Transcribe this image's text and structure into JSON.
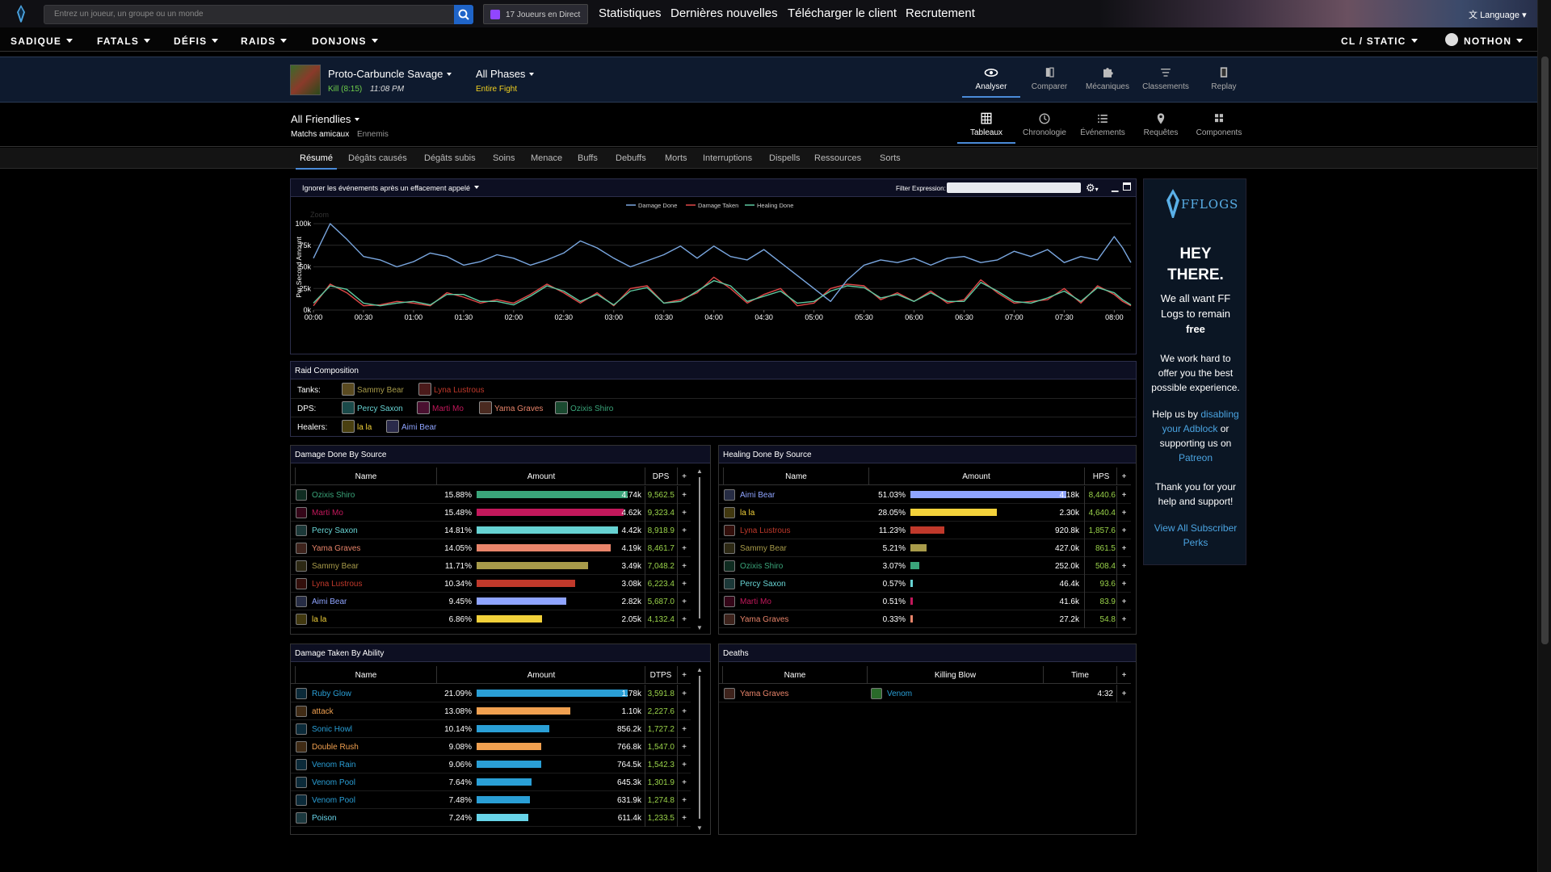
{
  "topbar": {
    "search_placeholder": "Entrez un joueur, un groupe ou un monde",
    "live_label": "17 Joueurs en Direct",
    "nav": [
      "Statistiques",
      "Dernières nouvelles",
      "Télécharger le client",
      "Recrutement"
    ],
    "language": "Language"
  },
  "menubar": {
    "left": [
      "SADIQUE",
      "FATALS",
      "DÉFIS",
      "RAIDS",
      "DONJONS"
    ],
    "static": "CL / STATIC",
    "user": "NOTHON"
  },
  "report": {
    "boss": "Proto-Carbuncle Savage",
    "kill": "Kill (8:15)",
    "time": "11:08 PM",
    "phases": "All Phases",
    "phase_sub": "Entire Fight",
    "view_tabs": [
      "Analyser",
      "Comparer",
      "Mécaniques",
      "Classements",
      "Replay"
    ],
    "view_icons": [
      "eye-icon",
      "compare-icon",
      "puzzle-icon",
      "rankings-icon",
      "replay-icon"
    ]
  },
  "filter": {
    "friendlies": "All Friendlies",
    "matches": "Matchs amicaux",
    "enemies": "Ennemis",
    "mode_tabs": [
      "Tableaux",
      "Chronologie",
      "Événements",
      "Requêtes",
      "Components"
    ],
    "mode_icons": [
      "table-icon",
      "clock-icon",
      "list-icon",
      "pin-icon",
      "grid-icon"
    ]
  },
  "subtabs": [
    "Résumé",
    "Dégâts causés",
    "Dégâts subis",
    "Soins",
    "Menace",
    "Buffs",
    "Debuffs",
    "Morts",
    "Interruptions",
    "Dispells",
    "Ressources",
    "Sorts"
  ],
  "chart_panel": {
    "ignore_label": "Ignorer les événements après un effacement appelé",
    "filter_label": "Filter Expression:",
    "zoom_label": "Zoom"
  },
  "chart_data": {
    "type": "line",
    "ylabel": "Per Second Amount",
    "yticks": [
      "0k",
      "25k",
      "50k",
      "75k",
      "100k"
    ],
    "xticks": [
      "00:00",
      "00:30",
      "01:00",
      "01:30",
      "02:00",
      "02:30",
      "03:00",
      "03:30",
      "04:00",
      "04:30",
      "05:00",
      "05:30",
      "06:00",
      "06:30",
      "07:00",
      "07:30",
      "08:00"
    ],
    "ylim": [
      0,
      100
    ],
    "xlim": [
      0,
      490
    ],
    "series": [
      {
        "name": "Damage Done",
        "color": "#7aa7e0",
        "x": [
          0,
          10,
          20,
          30,
          40,
          50,
          60,
          70,
          80,
          90,
          100,
          110,
          120,
          130,
          140,
          150,
          160,
          170,
          180,
          190,
          200,
          210,
          220,
          230,
          240,
          250,
          260,
          270,
          280,
          290,
          300,
          310,
          320,
          330,
          340,
          350,
          360,
          370,
          380,
          390,
          400,
          410,
          420,
          430,
          440,
          450,
          460,
          470,
          480,
          485,
          490
        ],
        "y": [
          60,
          100,
          82,
          62,
          58,
          50,
          56,
          66,
          62,
          52,
          56,
          64,
          60,
          52,
          58,
          66,
          80,
          72,
          60,
          50,
          57,
          64,
          74,
          60,
          74,
          62,
          58,
          70,
          55,
          40,
          25,
          10,
          35,
          52,
          58,
          55,
          60,
          52,
          60,
          62,
          55,
          58,
          68,
          62,
          70,
          55,
          62,
          58,
          85,
          72,
          55
        ]
      },
      {
        "name": "Damage Taken",
        "color": "#e04848",
        "x": [
          0,
          10,
          20,
          30,
          40,
          50,
          60,
          70,
          80,
          90,
          100,
          110,
          120,
          130,
          140,
          150,
          160,
          170,
          180,
          190,
          200,
          210,
          220,
          230,
          240,
          250,
          260,
          270,
          280,
          290,
          300,
          310,
          320,
          330,
          340,
          350,
          360,
          370,
          380,
          390,
          400,
          410,
          420,
          430,
          440,
          450,
          460,
          470,
          480,
          485,
          490
        ],
        "y": [
          5,
          30,
          20,
          5,
          6,
          10,
          8,
          5,
          20,
          15,
          8,
          12,
          8,
          18,
          30,
          20,
          8,
          20,
          5,
          25,
          28,
          8,
          12,
          20,
          38,
          25,
          8,
          18,
          25,
          5,
          8,
          25,
          30,
          28,
          12,
          20,
          10,
          22,
          8,
          12,
          35,
          20,
          8,
          10,
          12,
          25,
          8,
          28,
          18,
          10,
          5
        ]
      },
      {
        "name": "Healing Done",
        "color": "#5ec9a0",
        "x": [
          0,
          10,
          20,
          30,
          40,
          50,
          60,
          70,
          80,
          90,
          100,
          110,
          120,
          130,
          140,
          150,
          160,
          170,
          180,
          190,
          200,
          210,
          220,
          230,
          240,
          250,
          260,
          270,
          280,
          290,
          300,
          310,
          320,
          330,
          340,
          350,
          360,
          370,
          380,
          390,
          400,
          410,
          420,
          430,
          440,
          450,
          460,
          470,
          480,
          485,
          490
        ],
        "y": [
          8,
          28,
          24,
          8,
          5,
          8,
          10,
          6,
          18,
          18,
          10,
          10,
          6,
          16,
          28,
          22,
          10,
          18,
          6,
          22,
          26,
          8,
          10,
          22,
          34,
          28,
          10,
          16,
          22,
          8,
          10,
          22,
          28,
          26,
          14,
          18,
          10,
          20,
          10,
          10,
          32,
          22,
          10,
          8,
          14,
          22,
          10,
          26,
          20,
          12,
          6
        ]
      }
    ]
  },
  "raid_comp": {
    "title": "Raid Composition",
    "rows": [
      {
        "label": "Tanks:",
        "players": [
          {
            "name": "Sammy Bear",
            "color": "#a89b4a"
          },
          {
            "name": "Lyna Lustrous",
            "color": "#c0392b"
          }
        ]
      },
      {
        "label": "DPS:",
        "players": [
          {
            "name": "Percy Saxon",
            "color": "#67d3d3"
          },
          {
            "name": "Marti Mo",
            "color": "#c2185b"
          },
          {
            "name": "Yama Graves",
            "color": "#e8846a"
          },
          {
            "name": "Ozixis Shiro",
            "color": "#3aa57a"
          }
        ]
      },
      {
        "label": "Healers:",
        "players": [
          {
            "name": "la la",
            "color": "#f2d13a"
          },
          {
            "name": "Aimi Bear",
            "color": "#8fa4ff"
          }
        ]
      }
    ]
  },
  "damage_done": {
    "title": "Damage Done By Source",
    "cols": [
      "Name",
      "Amount",
      "DPS",
      "+"
    ],
    "rows": [
      {
        "name": "Ozixis Shiro",
        "pct": "15.88%",
        "amt": "4.74k",
        "rate": "9,562.5",
        "frac": 1.0,
        "color": "#3aa57a"
      },
      {
        "name": "Marti Mo",
        "pct": "15.48%",
        "amt": "4.62k",
        "rate": "9,323.4",
        "frac": 0.975,
        "color": "#c2185b"
      },
      {
        "name": "Percy Saxon",
        "pct": "14.81%",
        "amt": "4.42k",
        "rate": "8,918.9",
        "frac": 0.933,
        "color": "#67d3d3"
      },
      {
        "name": "Yama Graves",
        "pct": "14.05%",
        "amt": "4.19k",
        "rate": "8,461.7",
        "frac": 0.885,
        "color": "#e8846a"
      },
      {
        "name": "Sammy Bear",
        "pct": "11.71%",
        "amt": "3.49k",
        "rate": "7,048.2",
        "frac": 0.737,
        "color": "#a89b4a"
      },
      {
        "name": "Lyna Lustrous",
        "pct": "10.34%",
        "amt": "3.08k",
        "rate": "6,223.4",
        "frac": 0.651,
        "color": "#c0392b"
      },
      {
        "name": "Aimi Bear",
        "pct": "9.45%",
        "amt": "2.82k",
        "rate": "5,687.0",
        "frac": 0.595,
        "color": "#8fa4ff"
      },
      {
        "name": "la la",
        "pct": "6.86%",
        "amt": "2.05k",
        "rate": "4,132.4",
        "frac": 0.432,
        "color": "#f2d13a"
      }
    ]
  },
  "healing_done": {
    "title": "Healing Done By Source",
    "cols": [
      "Name",
      "Amount",
      "HPS",
      "+"
    ],
    "rows": [
      {
        "name": "Aimi Bear",
        "pct": "51.03%",
        "amt": "4.18k",
        "rate": "8,440.6",
        "frac": 1.0,
        "color": "#8fa4ff"
      },
      {
        "name": "la la",
        "pct": "28.05%",
        "amt": "2.30k",
        "rate": "4,640.4",
        "frac": 0.55,
        "color": "#f2d13a"
      },
      {
        "name": "Lyna Lustrous",
        "pct": "11.23%",
        "amt": "920.8k",
        "rate": "1,857.6",
        "frac": 0.22,
        "color": "#c0392b"
      },
      {
        "name": "Sammy Bear",
        "pct": "5.21%",
        "amt": "427.0k",
        "rate": "861.5",
        "frac": 0.102,
        "color": "#a89b4a"
      },
      {
        "name": "Ozixis Shiro",
        "pct": "3.07%",
        "amt": "252.0k",
        "rate": "508.4",
        "frac": 0.06,
        "color": "#3aa57a"
      },
      {
        "name": "Percy Saxon",
        "pct": "0.57%",
        "amt": "46.4k",
        "rate": "93.6",
        "frac": 0.011,
        "color": "#67d3d3"
      },
      {
        "name": "Marti Mo",
        "pct": "0.51%",
        "amt": "41.6k",
        "rate": "83.9",
        "frac": 0.01,
        "color": "#c2185b"
      },
      {
        "name": "Yama Graves",
        "pct": "0.33%",
        "amt": "27.2k",
        "rate": "54.8",
        "frac": 0.006,
        "color": "#e8846a"
      }
    ]
  },
  "damage_taken": {
    "title": "Damage Taken By Ability",
    "cols": [
      "Name",
      "Amount",
      "DTPS",
      "+"
    ],
    "rows": [
      {
        "name": "Ruby Glow",
        "pct": "21.09%",
        "amt": "1.78k",
        "rate": "3,591.8",
        "frac": 1.0,
        "color": "#2a9fd6"
      },
      {
        "name": "attack",
        "pct": "13.08%",
        "amt": "1.10k",
        "rate": "2,227.6",
        "frac": 0.62,
        "color": "#f0a050"
      },
      {
        "name": "Sonic Howl",
        "pct": "10.14%",
        "amt": "856.2k",
        "rate": "1,727.2",
        "frac": 0.481,
        "color": "#2a9fd6"
      },
      {
        "name": "Double Rush",
        "pct": "9.08%",
        "amt": "766.8k",
        "rate": "1,547.0",
        "frac": 0.43,
        "color": "#f0a050"
      },
      {
        "name": "Venom Rain",
        "pct": "9.06%",
        "amt": "764.5k",
        "rate": "1,542.3",
        "frac": 0.43,
        "color": "#2a9fd6"
      },
      {
        "name": "Venom Pool",
        "pct": "7.64%",
        "amt": "645.3k",
        "rate": "1,301.9",
        "frac": 0.362,
        "color": "#2a9fd6"
      },
      {
        "name": "Venom Pool",
        "pct": "7.48%",
        "amt": "631.9k",
        "rate": "1,274.8",
        "frac": 0.355,
        "color": "#2a9fd6"
      },
      {
        "name": "Poison",
        "pct": "7.24%",
        "amt": "611.4k",
        "rate": "1,233.5",
        "frac": 0.343,
        "color": "#67d3e8"
      }
    ]
  },
  "deaths": {
    "title": "Deaths",
    "cols": [
      "Name",
      "Killing Blow",
      "Time",
      "+"
    ],
    "rows": [
      {
        "name": "Yama Graves",
        "color": "#e8846a",
        "blow": "Venom",
        "time": "4:32"
      }
    ]
  },
  "ad": {
    "brand": "FFLOGS",
    "hey": "HEY",
    "there": "THERE.",
    "l1": "We all want FF",
    "l2": "Logs to remain",
    "free": "free",
    "l3": "We work hard to",
    "l4": "offer you the best",
    "l5": "possible experience.",
    "l6": "Help us by",
    "link1": "disabling",
    "link1b": "your Adblock",
    "l7": "or",
    "l8": "supporting us on",
    "link2": "Patreon",
    "l9": "Thank you for your",
    "l10": "help and support!",
    "link3": "View All Subscriber",
    "link3b": "Perks"
  }
}
